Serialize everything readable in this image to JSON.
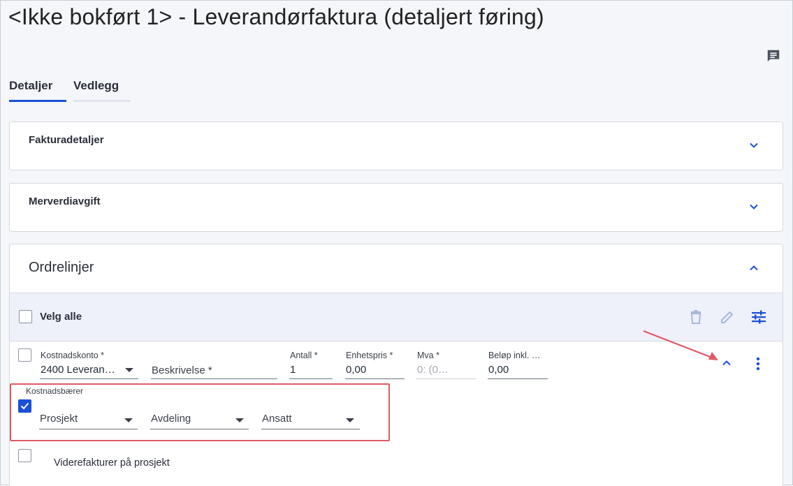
{
  "page": {
    "title": "<Ikke bokført 1> - Leverandørfaktura (detaljert føring)"
  },
  "tabs": [
    {
      "label": "Detaljer",
      "active": true
    },
    {
      "label": "Vedlegg",
      "active": false
    }
  ],
  "sections": {
    "fakturadetaljer": {
      "title": "Fakturadetaljer",
      "expanded": false
    },
    "merverdiavgift": {
      "title": "Merverdiavgift",
      "expanded": false
    },
    "ordrelinjer": {
      "title": "Ordrelinjer",
      "expanded": true
    }
  },
  "select_all": {
    "label": "Velg alle",
    "checked": false
  },
  "line": {
    "kostnadskonto": {
      "label": "Kostnadskonto *",
      "value": "2400 Leveran…"
    },
    "beskrivelse": {
      "placeholder": "Beskrivelse *"
    },
    "antall": {
      "label": "Antall *",
      "value": "1"
    },
    "enhetspris": {
      "label": "Enhetspris *",
      "value": "0,00"
    },
    "mva": {
      "label": "Mva *",
      "value": "0: (0…"
    },
    "belop": {
      "label": "Beløp inkl. …",
      "value": "0,00"
    }
  },
  "kostnadsbaerer": {
    "label": "Kostnadsbærer",
    "checked": true,
    "prosjekt": "Prosjekt",
    "avdeling": "Avdeling",
    "ansatt": "Ansatt"
  },
  "viderefakturer": {
    "label": "Viderefakturer på prosjekt",
    "checked": false
  },
  "colors": {
    "accent": "#1a4fd6",
    "highlight": "#e05a66",
    "select_bar_bg": "#eef0fa"
  },
  "icons": [
    "comment-icon",
    "chevron-down-icon",
    "chevron-up-icon",
    "delete-icon",
    "edit-icon",
    "tune-icon",
    "more-vert-icon",
    "check-icon"
  ]
}
